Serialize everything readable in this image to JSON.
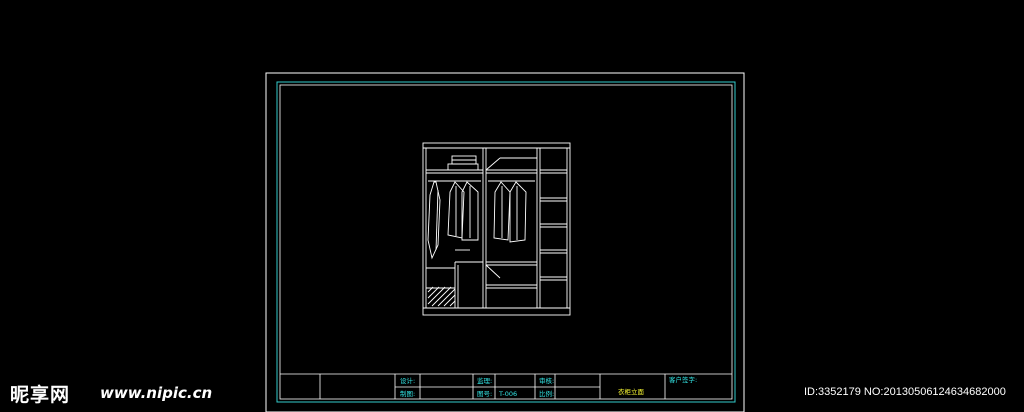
{
  "drawing": {
    "title_block": {
      "design_label": "设计:",
      "checker_label": "监理:",
      "reviewer_label": "审核:",
      "client_sign_label": "客户签字:",
      "draw_label": "制图:",
      "drawing_no_label": "图号:",
      "drawing_no_value": "T-006",
      "scale_label": "比例:",
      "drawing_name": "衣柜立面"
    },
    "colors": {
      "background": "#000000",
      "frame_white": "#ffffff",
      "frame_cyan": "#33cccc",
      "text_cyan": "#33e6e6",
      "text_yellow": "#ffff33"
    }
  },
  "watermark": {
    "logo_text": "昵享网",
    "url_text": "www.nipic.cn",
    "id_text": "ID:3352179 NO:20130506124634682000"
  }
}
